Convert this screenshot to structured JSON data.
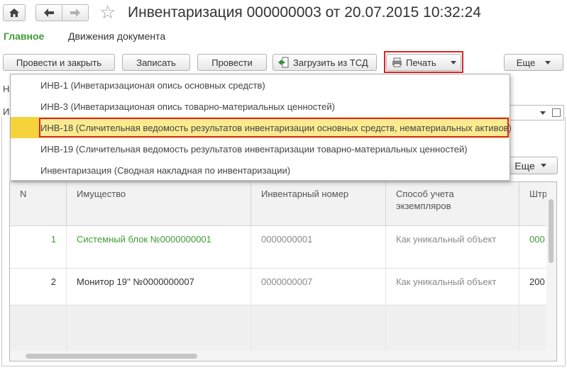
{
  "window": {
    "title": "Инвентаризация 000000003 от 20.07.2015 10:32:24"
  },
  "nav": {
    "main": "Главное",
    "movements": "Движения документа"
  },
  "toolbar": {
    "post_close": "Провести и закрыть",
    "save": "Записать",
    "post": "Провести",
    "load_tsd": "Загрузить из ТСД",
    "print": "Печать",
    "more": "Еще"
  },
  "form": {
    "frag_n": "Н",
    "frag_i": "И"
  },
  "print_menu": {
    "items": [
      "ИНВ-1 (Инветаризационая опись основных средств)",
      "ИНВ-3 (Инветаризационая опись товарно-материальных ценностей)",
      "ИНВ-18 (Сличительная ведомость результатов инвентаризации основных средств, нематериальных активов)",
      "ИНВ-19 (Сличительная ведомость результатов инвентаризации товарно-материальных ценностей)",
      "Инвентаризация (Сводная накладная по инвентаризации)"
    ],
    "selected_index": 2
  },
  "table": {
    "more": "Еще",
    "columns": [
      "N",
      "Имущество",
      "Инвентарный номер",
      "Способ учета\nэкземпляров",
      "Штр"
    ],
    "rows": [
      {
        "n": "1",
        "asset": "Системный блок №0000000001",
        "inv": "0000000001",
        "method": "Как уникальный объект",
        "barcode": "000"
      },
      {
        "n": "2",
        "asset": "Монитор 19'' №0000000007",
        "inv": "0000000007",
        "method": "Как уникальный объект",
        "barcode": "200"
      }
    ]
  },
  "colors": {
    "accent_green": "#3f9c35",
    "highlight_red": "#d6262b",
    "selected_row": "#fbeb8f"
  }
}
